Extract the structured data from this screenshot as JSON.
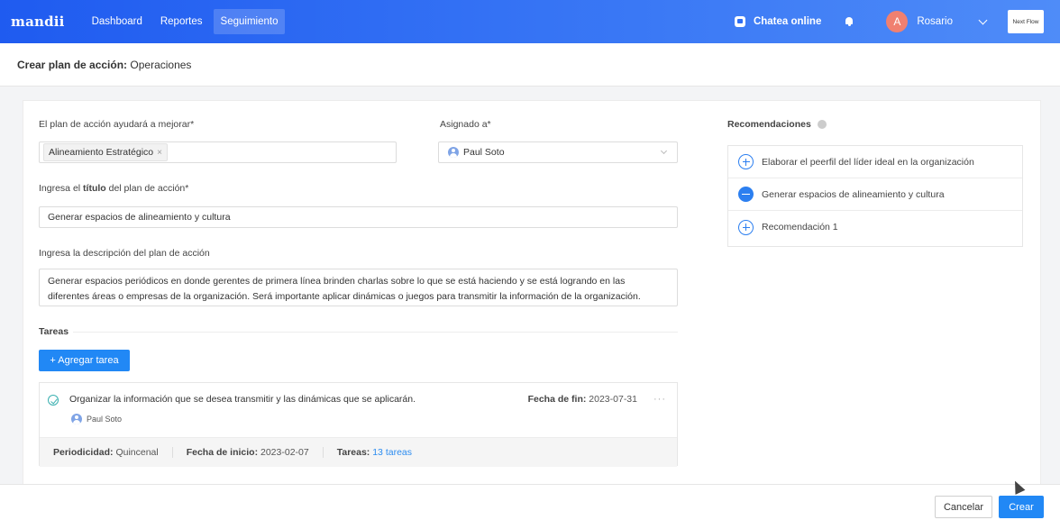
{
  "topbar": {
    "logo": "mandii",
    "nav": [
      "Dashboard",
      "Reportes",
      "Seguimiento"
    ],
    "chat_label": "Chatea online",
    "avatar_initial": "A",
    "user_name": "Rosario",
    "next_flow": "Next Flow",
    "icons": {
      "chat": "chat-bubble-icon",
      "bell": "bell-icon",
      "dropdown": "chevron-down-icon"
    },
    "colors": {
      "bar_start": "#1f5bf0",
      "bar_end": "#4f8cf8",
      "avatar": "#f08070"
    }
  },
  "breadcrumb": {
    "prefix": "Crear plan de acción:",
    "area": "Operaciones"
  },
  "form": {
    "improve_label": "El plan de acción ayudará a mejorar*",
    "improve_tag": "Alineamiento Estratégico",
    "improve_tag_remove": "×",
    "assigned_label": "Asignado a*",
    "assigned_value": "Paul Soto",
    "title_label_pre": "Ingresa el",
    "title_label_bold": "título",
    "title_label_post": "del plan de acción*",
    "title_value": "Generar espacios de alineamiento y cultura",
    "desc_label": "Ingresa la descripción del plan de acción",
    "desc_value": "Generar espacios periódicos en donde gerentes de primera línea brinden charlas sobre lo que se está haciendo y se está logrando en las diferentes áreas o empresas de la organización. Será importante aplicar dinámicas o juegos para transmitir la información de la organización."
  },
  "tasks": {
    "section_title": "Tareas",
    "add_button": "+ Agregar tarea",
    "items": [
      {
        "title": "Organizar la información que se desea transmitir y las dinámicas que se aplicarán.",
        "assignee": "Paul Soto",
        "end_label": "Fecha de fin:",
        "end_date": "2023-07-31",
        "more": "···",
        "periodicity_label": "Periodicidad:",
        "periodicity": "Quincenal",
        "start_label": "Fecha de inicio:",
        "start_date": "2023-02-07",
        "tasks_label": "Tareas:",
        "tasks_link": "13 tareas"
      }
    ]
  },
  "recommendations": {
    "title": "Recomendaciones",
    "items": [
      {
        "label": "Elaborar el peerfil del líder ideal en la organización",
        "state": "add"
      },
      {
        "label": "Generar espacios de alineamiento y cultura",
        "state": "selected"
      },
      {
        "label": "Recomendación 1",
        "state": "add"
      }
    ]
  },
  "footer": {
    "cancel": "Cancelar",
    "create": "Crear",
    "primary_color": "#2188f5"
  }
}
